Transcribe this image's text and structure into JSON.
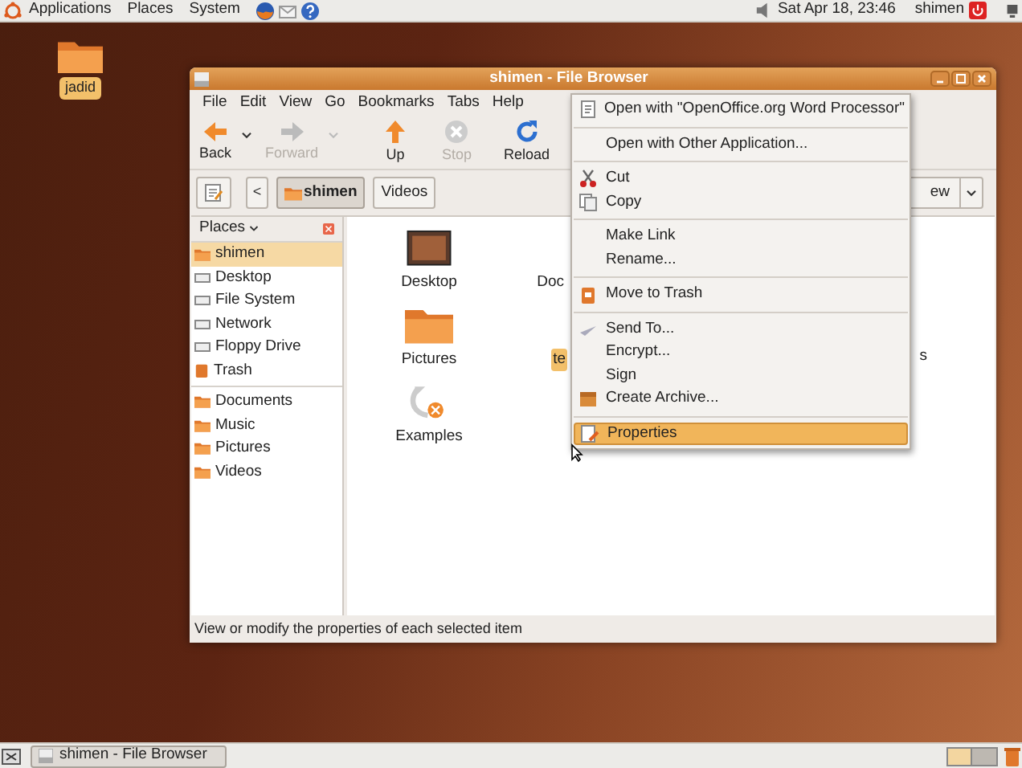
{
  "top_panel": {
    "menus": [
      "Applications",
      "Places",
      "System"
    ],
    "clock": "Sat Apr 18, 23:46",
    "user": "shimen"
  },
  "desktop_icons": [
    {
      "label": "jadid"
    }
  ],
  "window": {
    "title": "shimen - File Browser",
    "menubar": [
      "File",
      "Edit",
      "View",
      "Go",
      "Bookmarks",
      "Tabs",
      "Help"
    ],
    "toolbar": [
      {
        "label": "Back",
        "disabled": false,
        "dropdown": true
      },
      {
        "label": "Forward",
        "disabled": true,
        "dropdown": true
      },
      {
        "label": "Up",
        "disabled": false,
        "dropdown": false
      },
      {
        "label": "Stop",
        "disabled": true,
        "dropdown": false
      },
      {
        "label": "Reload",
        "disabled": false,
        "dropdown": false
      }
    ],
    "path_bar": {
      "back_glyph": "<",
      "crumbs": [
        {
          "label": "shimen",
          "selected": true
        },
        {
          "label": "Videos",
          "selected": false
        }
      ]
    },
    "view_selector": "ew",
    "sidebar": {
      "title": "Places",
      "places": [
        {
          "label": "shimen",
          "selected": true
        },
        {
          "label": "Desktop",
          "selected": false
        },
        {
          "label": "File System",
          "selected": false
        },
        {
          "label": "Network",
          "selected": false
        },
        {
          "label": "Floppy Drive",
          "selected": false
        },
        {
          "label": "Trash",
          "selected": false
        }
      ],
      "bookmarks": [
        {
          "label": "Documents",
          "selected": false
        },
        {
          "label": "Music",
          "selected": false
        },
        {
          "label": "Pictures",
          "selected": false
        },
        {
          "label": "Videos",
          "selected": false
        }
      ]
    },
    "files": [
      {
        "label": "Desktop",
        "selected": false
      },
      {
        "label": "Pictures",
        "selected": false
      },
      {
        "label": "Examples",
        "selected": false
      }
    ],
    "files_column_2": [
      {
        "label": "Doc",
        "selected": false
      },
      {
        "label": "te",
        "selected": true
      }
    ],
    "files_column_3": [
      {
        "label": "s",
        "selected": false
      }
    ],
    "status_bar": "View or modify the properties of each selected item"
  },
  "context_menu": [
    {
      "kind": "item",
      "label": "Open with \"OpenOffice.org Word Processor\"",
      "selected": false
    },
    {
      "kind": "separator"
    },
    {
      "kind": "item",
      "label": "Open with Other Application...",
      "selected": false
    },
    {
      "kind": "separator"
    },
    {
      "kind": "item",
      "label": "Cut",
      "selected": false
    },
    {
      "kind": "item",
      "label": "Copy",
      "selected": false
    },
    {
      "kind": "separator"
    },
    {
      "kind": "item",
      "label": "Make Link",
      "selected": false
    },
    {
      "kind": "item",
      "label": "Rename...",
      "selected": false
    },
    {
      "kind": "separator"
    },
    {
      "kind": "item",
      "label": "Move to Trash",
      "selected": false
    },
    {
      "kind": "separator"
    },
    {
      "kind": "item",
      "label": "Send To...",
      "selected": false
    },
    {
      "kind": "item",
      "label": "Encrypt...",
      "selected": false
    },
    {
      "kind": "item",
      "label": "Sign",
      "selected": false
    },
    {
      "kind": "item",
      "label": "Create Archive...",
      "selected": false
    },
    {
      "kind": "separator"
    },
    {
      "kind": "item",
      "label": "Properties",
      "selected": true
    }
  ],
  "taskbar": {
    "tasks": [
      {
        "label": "shimen - File Browser"
      }
    ]
  }
}
